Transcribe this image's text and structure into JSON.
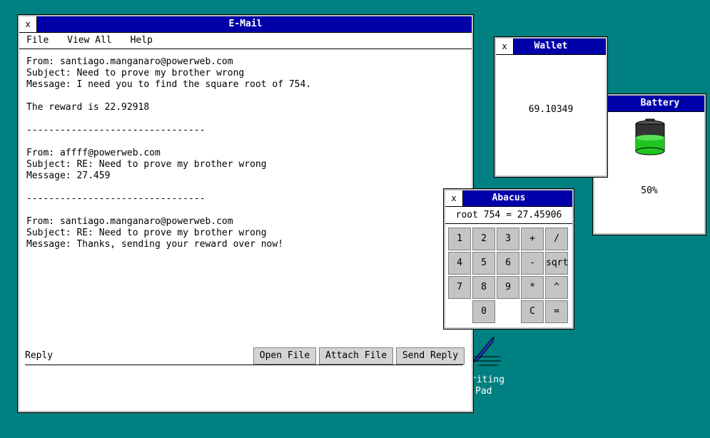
{
  "email": {
    "title": "E-Mail",
    "close": "x",
    "menu": [
      "File",
      "View All",
      "Help"
    ],
    "lines": [
      "From: santiago.manganaro@powerweb.com",
      "Subject: Need to prove my brother wrong",
      "Message: I need you to find the square root of 754.",
      "",
      "The reward is 22.92918",
      "",
      "--------------------------------",
      "",
      "From: affff@powerweb.com",
      "Subject: RE: Need to prove my brother wrong",
      "Message: 27.459",
      "",
      "--------------------------------",
      "",
      "From: santiago.manganaro@powerweb.com",
      "Subject: RE: Need to prove my brother wrong",
      "Message: Thanks, sending your reward over now!"
    ],
    "reply_label": "Reply",
    "buttons": {
      "open": "Open File",
      "attach": "Attach File",
      "send": "Send Reply"
    },
    "reply_text": ""
  },
  "wallet": {
    "title": "Wallet",
    "close": "x",
    "value": "69.10349"
  },
  "battery": {
    "title": "Battery",
    "level_text": "50%",
    "level": 0.5,
    "fill_color": "#22c422"
  },
  "abacus": {
    "title": "Abacus",
    "close": "x",
    "display": "root 754 = 27.45906",
    "keys": [
      "1",
      "2",
      "3",
      "+",
      "/",
      "4",
      "5",
      "6",
      "-",
      "sqrt",
      "7",
      "8",
      "9",
      "*",
      "^",
      "0",
      "C",
      "="
    ]
  },
  "desktop": {
    "writing_pad_line1": "riting",
    "writing_pad_line2": "Pad"
  }
}
